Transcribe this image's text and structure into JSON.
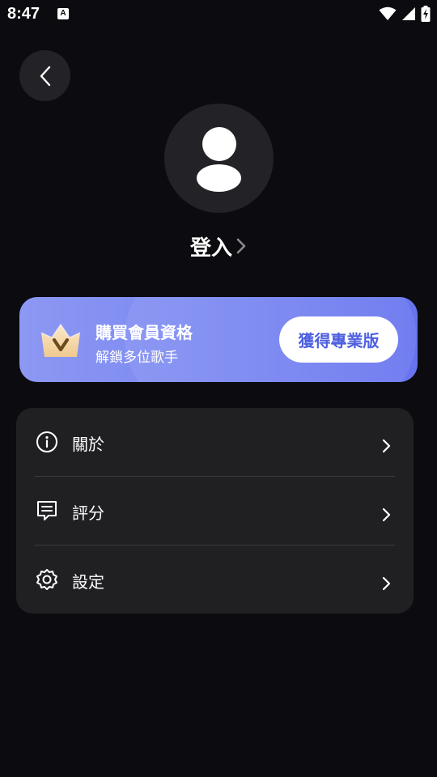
{
  "status_bar": {
    "time": "8:47",
    "icons": [
      "notification-icon",
      "wifi-icon",
      "cellular-signal-icon",
      "battery-charging-icon"
    ]
  },
  "header": {
    "back_icon": "chevron-left-icon"
  },
  "profile": {
    "avatar_icon": "user-avatar-icon",
    "login_label": "登入"
  },
  "premium": {
    "icon": "crown-icon",
    "title": "購買會員資格",
    "subtitle": "解鎖多位歌手",
    "button_label": "獲得專業版",
    "colors": {
      "gradient_start": "#8d98f3",
      "gradient_end": "#6774ef",
      "button_text": "#4d5fe0"
    }
  },
  "menu": {
    "items": [
      {
        "icon": "info-icon",
        "label": "關於"
      },
      {
        "icon": "feedback-icon",
        "label": "評分"
      },
      {
        "icon": "gear-icon",
        "label": "設定"
      }
    ]
  },
  "colors": {
    "background": "#0c0b10",
    "card": "#202023"
  }
}
